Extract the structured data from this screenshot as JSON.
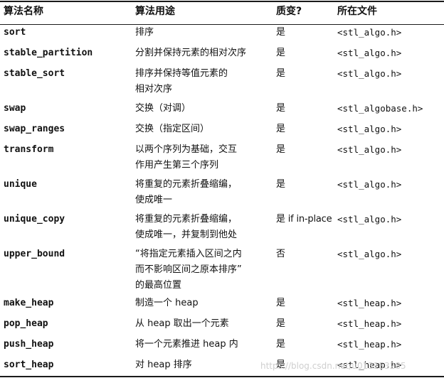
{
  "header": {
    "name": "算法名称",
    "use": "算法用途",
    "mutating": "质变?",
    "file": "所在文件"
  },
  "rows": [
    {
      "name": "sort",
      "use": "排序",
      "mutating": "是",
      "file": "<stl_algo.h>"
    },
    {
      "name": "stable_partition",
      "use": "分割并保持元素的相对次序",
      "mutating": "是",
      "file": "<stl_algo.h>"
    },
    {
      "name": "stable_sort",
      "use": "排序并保持等值元素的\n相对次序",
      "mutating": "是",
      "file": "<stl_algo.h>"
    },
    {
      "name": "swap",
      "use": "交换（对调）",
      "mutating": "是",
      "file": "<stl_algobase.h>"
    },
    {
      "name": "swap_ranges",
      "use": "交换（指定区间）",
      "mutating": "是",
      "file": "<stl_algo.h>"
    },
    {
      "name": "transform",
      "use": "以两个序列为基础，交互\n作用产生第三个序列",
      "mutating": "是",
      "file": "<stl_algo.h>"
    },
    {
      "name": "unique",
      "use": "将重复的元素折叠缩编，\n使成唯一",
      "mutating": "是",
      "file": "<stl_algo.h>"
    },
    {
      "name": "unique_copy",
      "use": "将重复的元素折叠缩编，\n使成唯一，并复制到他处",
      "mutating": "是 if in-place",
      "file": "<stl_algo.h>"
    },
    {
      "name": "upper_bound",
      "use": "“将指定元素插入区间之内\n而不影响区间之原本排序”\n的最高位置",
      "mutating": "否",
      "file": "<stl_algo.h>"
    },
    {
      "name": "make_heap",
      "use": "制造一个 heap",
      "mutating": "是",
      "file": "<stl_heap.h>"
    },
    {
      "name": "pop_heap",
      "use": "从 heap 取出一个元素",
      "mutating": "是",
      "file": "<stl_heap.h>"
    },
    {
      "name": "push_heap",
      "use": "将一个元素推进 heap 内",
      "mutating": "是",
      "file": "<stl_heap.h>"
    },
    {
      "name": "sort_heap",
      "use": "对 heap 排序",
      "mutating": "是",
      "file": "<stl_heap.h>"
    }
  ],
  "watermark": "https://blog.csdn.net/u013153285"
}
